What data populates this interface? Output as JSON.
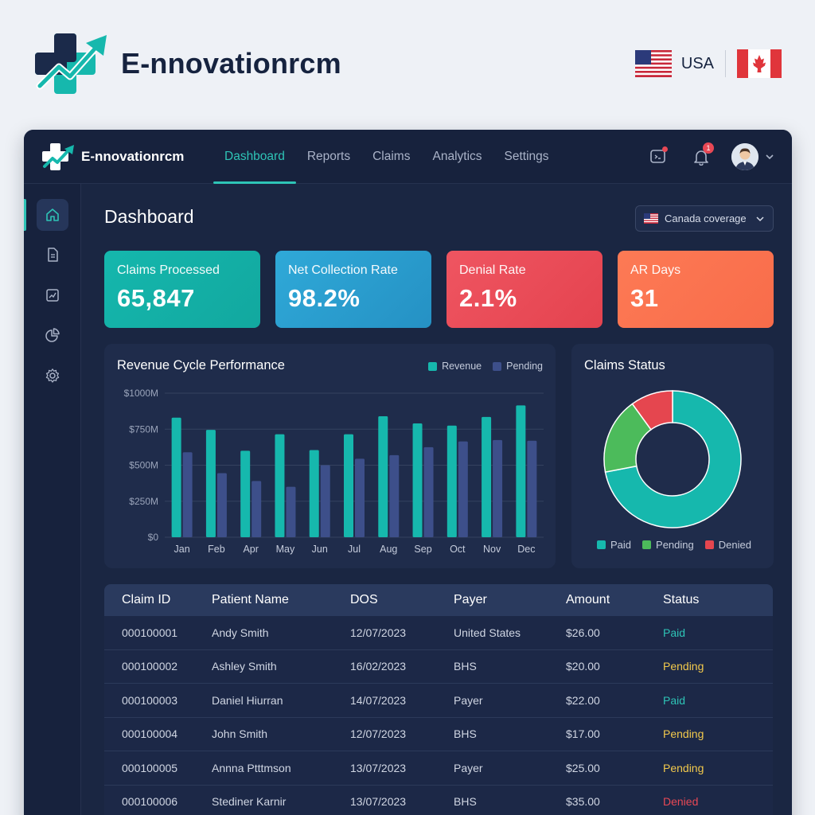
{
  "brand": {
    "name": "E-nnovationrcm"
  },
  "region": {
    "label": "USA"
  },
  "app": {
    "logo_text": "E-nnovationrcm",
    "nav": [
      {
        "label": "Dashboard",
        "active": true
      },
      {
        "label": "Reports"
      },
      {
        "label": "Claims"
      },
      {
        "label": "Analytics"
      },
      {
        "label": "Settings"
      }
    ],
    "notifications_count": "1",
    "sidebar_icons": [
      "home-icon",
      "document-icon",
      "chart-icon",
      "pie-chart-icon",
      "gear-icon"
    ]
  },
  "page": {
    "title": "Dashboard",
    "coverage_label": "Canada coverage"
  },
  "kpis": [
    {
      "label": "Claims Processed",
      "value": "65,847",
      "color": "#15b7ad"
    },
    {
      "label": "Net Collection Rate",
      "value": "98.2%",
      "color": "#2a9fd0"
    },
    {
      "label": "Denial Rate",
      "value": "2.1%",
      "color": "#ea4f5b"
    },
    {
      "label": "AR Days",
      "value": "31",
      "color": "#fb7550"
    }
  ],
  "colors": {
    "revenue": "#16b8ad",
    "pending_bar": "#3d4f8a",
    "paid": "#16b8ad",
    "pending": "#4cbb5b",
    "denied": "#e5464f",
    "status_paid": "#2ec4b6",
    "status_pending": "#f2c94c",
    "status_denied": "#e84855"
  },
  "chart_data": [
    {
      "type": "bar",
      "title": "Revenue Cycle Performance",
      "categories": [
        "Jan",
        "Feb",
        "Apr",
        "May",
        "Jun",
        "Jul",
        "Aug",
        "Sep",
        "Oct",
        "Nov",
        "Dec"
      ],
      "series": [
        {
          "name": "Revenue",
          "values": [
            830,
            745,
            600,
            715,
            605,
            715,
            840,
            790,
            775,
            835,
            915
          ]
        },
        {
          "name": "Pending",
          "values": [
            590,
            445,
            390,
            350,
            500,
            545,
            570,
            625,
            665,
            675,
            670
          ]
        }
      ],
      "y_ticks": [
        "$1000M",
        "$750M",
        "$500M",
        "$250M",
        "$0"
      ],
      "ylim": [
        0,
        1000
      ],
      "grid": true,
      "legend": "top-right"
    },
    {
      "type": "pie",
      "title": "Claims Status",
      "categories": [
        "Paid",
        "Pending",
        "Denied"
      ],
      "values": [
        72,
        18,
        10
      ],
      "legend": "bottom"
    }
  ],
  "table": {
    "headers": [
      "Claim ID",
      "Patient Name",
      "DOS",
      "Payer",
      "Amount",
      "Status"
    ],
    "rows": [
      {
        "claim_id": "000100001",
        "patient": "Andy Smith",
        "dos": "12/07/2023",
        "payer": "United States",
        "amount": "$26.00",
        "status": "Paid"
      },
      {
        "claim_id": "000100002",
        "patient": "Ashley Smith",
        "dos": "16/02/2023",
        "payer": "BHS",
        "amount": "$20.00",
        "status": "Pending"
      },
      {
        "claim_id": "000100003",
        "patient": "Daniel Hiurran",
        "dos": "14/07/2023",
        "payer": "Payer",
        "amount": "$22.00",
        "status": "Paid"
      },
      {
        "claim_id": "000100004",
        "patient": "John Smith",
        "dos": "12/07/2023",
        "payer": "BHS",
        "amount": "$17.00",
        "status": "Pending"
      },
      {
        "claim_id": "000100005",
        "patient": "Annna Ptttmson",
        "dos": "13/07/2023",
        "payer": "Payer",
        "amount": "$25.00",
        "status": "Pending"
      },
      {
        "claim_id": "000100006",
        "patient": "Stediner Karnir",
        "dos": "13/07/2023",
        "payer": "BHS",
        "amount": "$35.00",
        "status": "Denied"
      }
    ]
  }
}
